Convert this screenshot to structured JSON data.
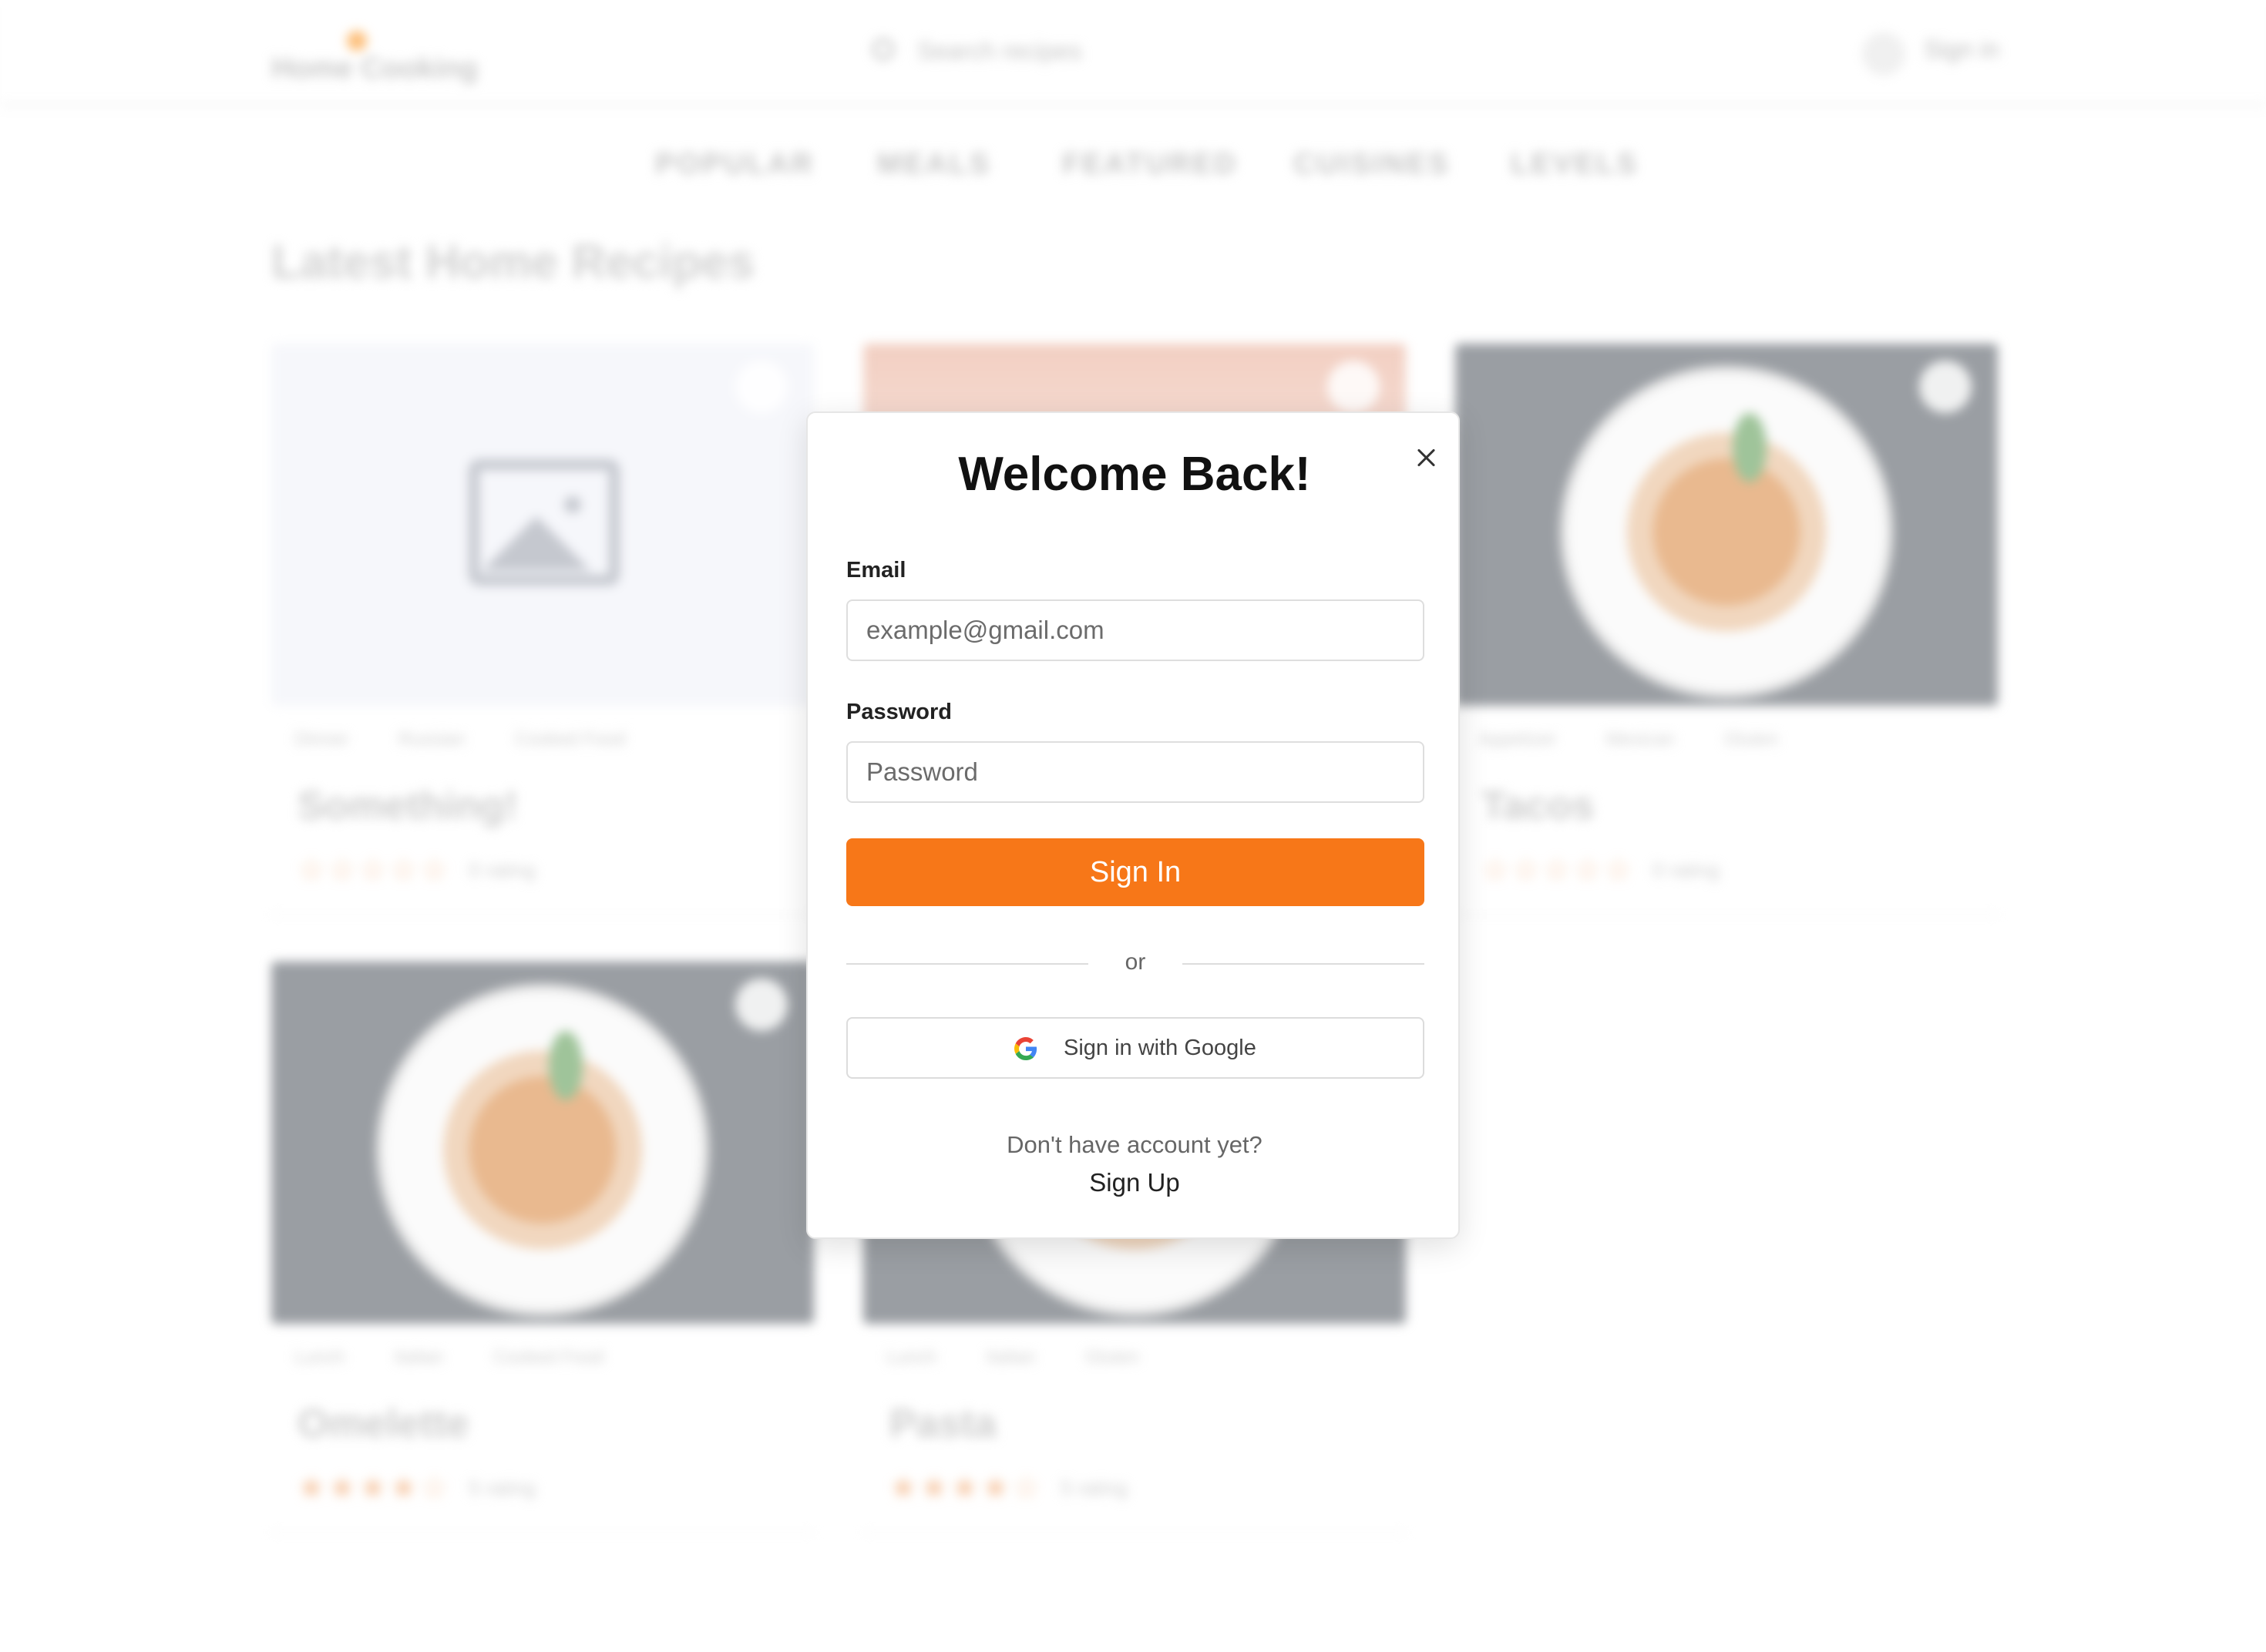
{
  "header": {
    "logo_text": "Home Cooking",
    "search_placeholder": "Search recipes",
    "sign_in_label": "Sign in"
  },
  "nav": {
    "items": [
      {
        "label": "POPULAR"
      },
      {
        "label": "MEALS"
      },
      {
        "label": "FEATURED"
      },
      {
        "label": "CUISINES"
      },
      {
        "label": "LEVELS"
      }
    ]
  },
  "section_title": "Latest Home Recipes",
  "recipes": [
    {
      "title": "Something!",
      "tags": [
        "Dinner",
        "Russian",
        "Cooked Food"
      ],
      "stars": "☆☆☆☆☆",
      "rating_text": "0 rating"
    },
    {
      "title": "",
      "tags": [],
      "stars": "",
      "rating_text": ""
    },
    {
      "title": "Tacos",
      "tags": [
        "Appetizer",
        "Mexican",
        "Gluten"
      ],
      "stars": "☆☆☆☆☆",
      "rating_text": "0 rating"
    },
    {
      "title": "Omelette",
      "tags": [
        "Lunch",
        "Italian",
        "Cooked Food"
      ],
      "stars": "★★★★☆",
      "rating_text": "5 rating"
    },
    {
      "title": "Pasta",
      "tags": [
        "Lunch",
        "Italian",
        "Gluten"
      ],
      "stars": "★★★★☆",
      "rating_text": "5 rating"
    }
  ],
  "modal": {
    "title": "Welcome Back!",
    "email_label": "Email",
    "email_placeholder": "example@gmail.com",
    "email_value": "",
    "password_label": "Password",
    "password_placeholder": "Password",
    "password_value": "",
    "submit_label": "Sign In",
    "divider_text": "or",
    "google_label": "Sign in with Google",
    "no_account_text": "Don't have account yet?",
    "signup_label": "Sign Up",
    "close_icon": "close-icon",
    "google_icon": "google-g-icon"
  },
  "colors": {
    "accent": "#f77718",
    "text_dark": "#111111",
    "muted": "#666666"
  }
}
